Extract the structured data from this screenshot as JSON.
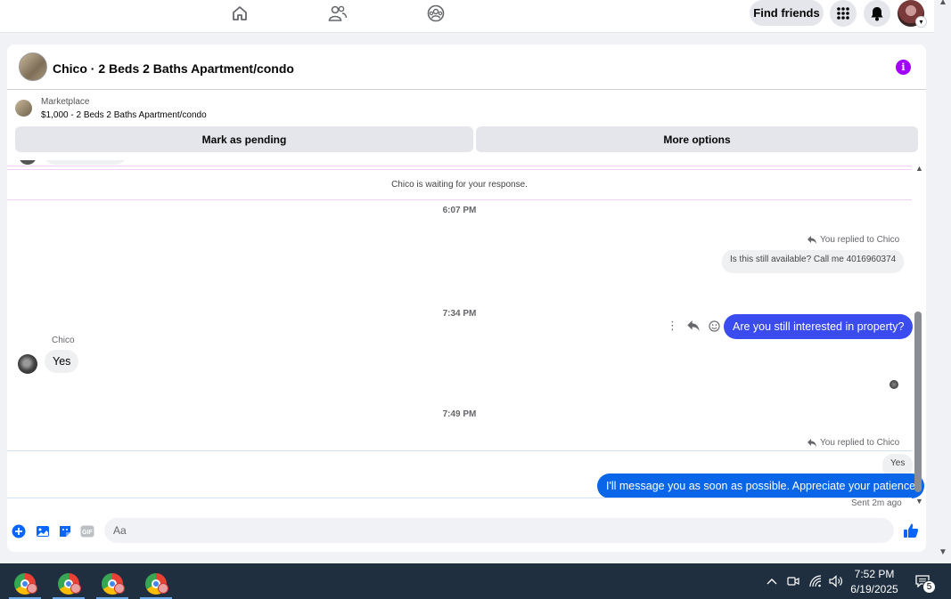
{
  "topnav": {
    "find_friends": "Find friends",
    "icons": [
      "home-icon",
      "friends-icon",
      "groups-icon",
      "menu-grid-icon",
      "bell-icon"
    ]
  },
  "chat": {
    "title": "Chico · 2 Beds 2 Baths Apartment/condo",
    "listing": {
      "source": "Marketplace",
      "title": "$1,000 - 2 Beds 2 Baths Apartment/condo"
    },
    "buttons": {
      "mark_pending": "Mark as pending",
      "more_options": "More options"
    },
    "waiting_notice": "Chico is waiting for your response.",
    "timestamps": [
      "6:07 PM",
      "7:34 PM",
      "7:49 PM"
    ],
    "msg1": {
      "replied_label": "You replied to Chico",
      "quoted": "Is this still available? Call me 4016960374",
      "text": "Are you still interested in property?"
    },
    "msg2": {
      "sender": "Chico",
      "text": "Yes"
    },
    "msg3": {
      "replied_label": "You replied to Chico",
      "quoted": "Yes",
      "text": "I'll message you as soon as possible. Appreciate your patience",
      "status": "Sent 2m ago"
    },
    "composer_placeholder": "Aa"
  },
  "taskbar": {
    "time": "7:52 PM",
    "date": "6/19/2025",
    "notification_count": "5",
    "app_count": 4
  },
  "colors": {
    "my_bubble": "#3a4bf0",
    "my_bubble_latest": "#0a66e8",
    "info_icon": "#a200ff",
    "taskbar": "#1f2f3f"
  }
}
